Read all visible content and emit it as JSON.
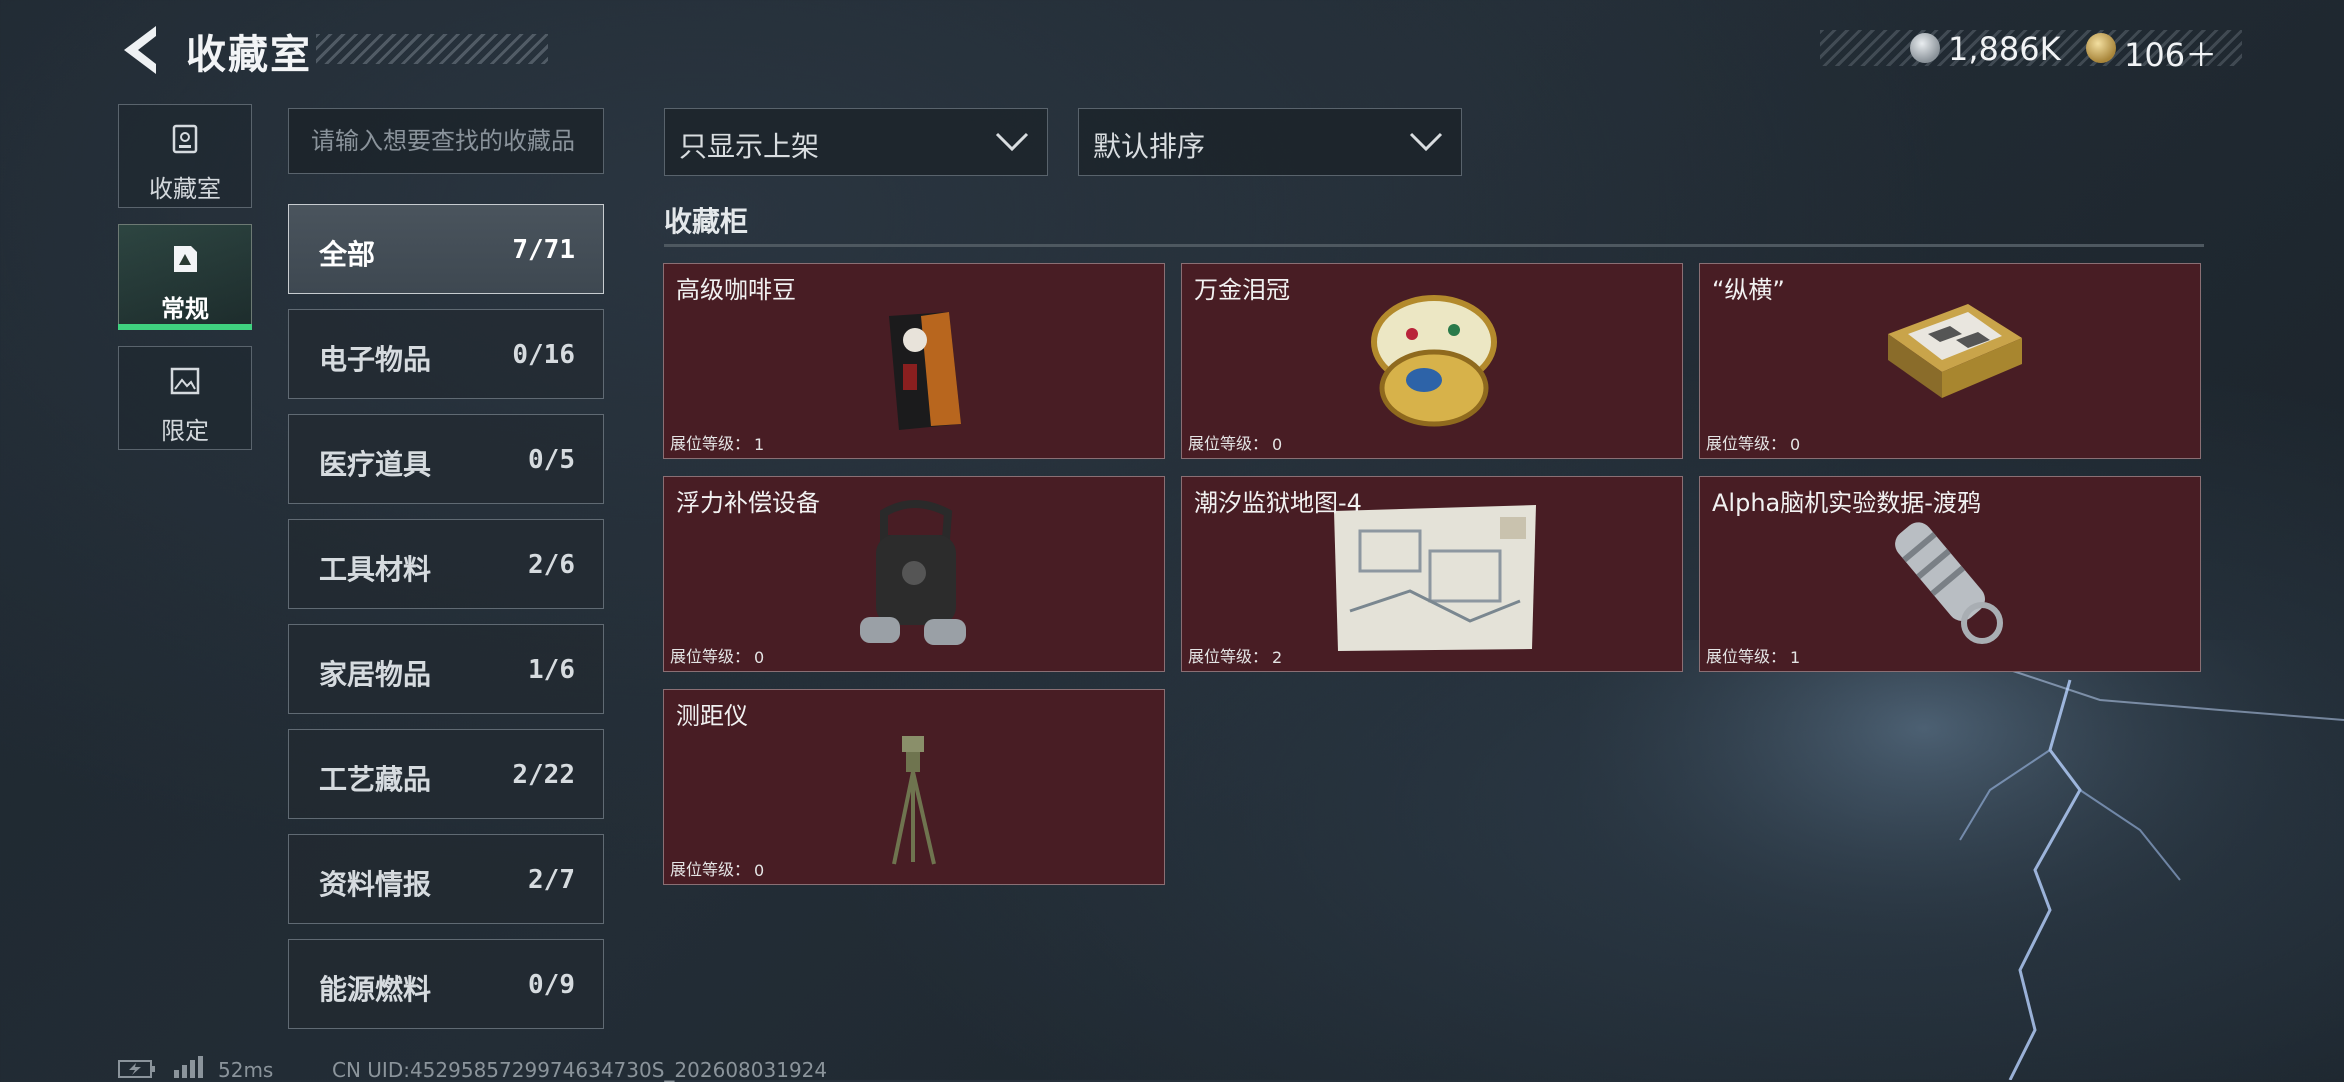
{
  "header": {
    "title": "收藏室",
    "currencies": [
      {
        "icon": "silver-coin-icon",
        "value": "1,886K"
      },
      {
        "icon": "gold-coin-icon",
        "value": "106＋"
      }
    ]
  },
  "left_nav": [
    {
      "label": "收藏室",
      "icon": "vault-icon",
      "selected": false
    },
    {
      "label": "常规",
      "icon": "document-icon",
      "selected": true
    },
    {
      "label": "限定",
      "icon": "image-icon",
      "selected": false
    }
  ],
  "search": {
    "placeholder": "请输入想要查找的收藏品"
  },
  "categories": [
    {
      "name": "全部",
      "count": "7/71",
      "active": true
    },
    {
      "name": "电子物品",
      "count": "0/16"
    },
    {
      "name": "医疗道具",
      "count": "0/5"
    },
    {
      "name": "工具材料",
      "count": "2/6"
    },
    {
      "name": "家居物品",
      "count": "1/6"
    },
    {
      "name": "工艺藏品",
      "count": "2/22"
    },
    {
      "name": "资料情报",
      "count": "2/7"
    },
    {
      "name": "能源燃料",
      "count": "0/9"
    }
  ],
  "filters": {
    "show_filter": "只显示上架",
    "sort": "默认排序"
  },
  "section": {
    "title": "收藏柜"
  },
  "items": [
    {
      "name": "高级咖啡豆",
      "level_label": "展位等级：",
      "level": "1",
      "icon": "coffee-bag-icon"
    },
    {
      "name": "万金泪冠",
      "level_label": "展位等级：",
      "level": "0",
      "icon": "jeweled-egg-icon"
    },
    {
      "name": "“纵横”",
      "level_label": "展位等级：",
      "level": "0",
      "icon": "chessboard-icon"
    },
    {
      "name": "浮力补偿设备",
      "level_label": "展位等级：",
      "level": "0",
      "icon": "buoyancy-vest-icon"
    },
    {
      "name": "潮汐监狱地图-4",
      "level_label": "展位等级：",
      "level": "2",
      "icon": "map-icon"
    },
    {
      "name": "Alpha脑机实验数据-渡鸦",
      "level_label": "展位等级：",
      "level": "1",
      "icon": "data-drive-icon"
    },
    {
      "name": "测距仪",
      "level_label": "展位等级：",
      "level": "0",
      "icon": "rangefinder-icon"
    }
  ],
  "status": {
    "ping": "52ms",
    "uid": "CN UID:4529585729974634730S_202608031924"
  },
  "colors": {
    "card_bg": "#481d24",
    "accent_green": "#3fd27f"
  }
}
